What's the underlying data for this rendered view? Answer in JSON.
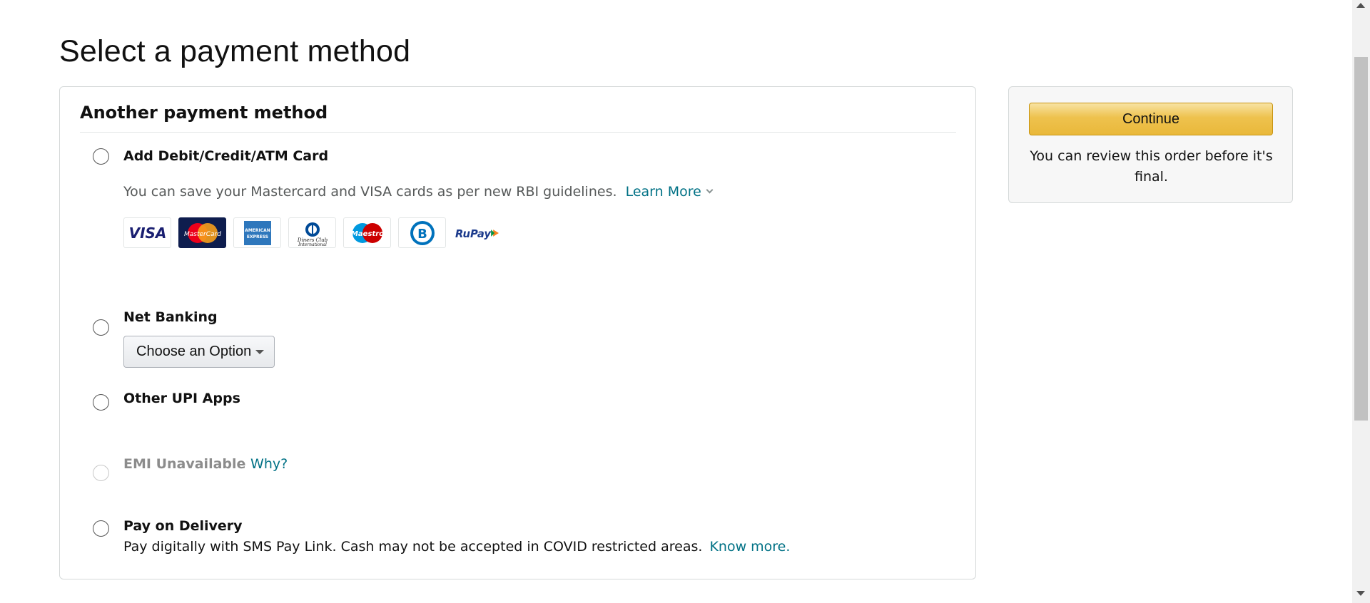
{
  "page": {
    "title": "Select a payment method"
  },
  "main": {
    "section_title": "Another payment method",
    "card_option": {
      "label": "Add Debit/Credit/ATM Card",
      "description": "You can save your Mastercard and VISA cards as per new RBI guidelines.",
      "learn_more": "Learn More",
      "card_logos": [
        "VISA",
        "MasterCard",
        "American Express",
        "Diners Club International",
        "Maestro",
        "Bajaj Finserv",
        "RuPay"
      ]
    },
    "net_banking": {
      "label": "Net Banking",
      "select_value": "Choose an Option"
    },
    "upi": {
      "label": "Other UPI Apps"
    },
    "emi": {
      "label": "EMI Unavailable",
      "why_link": "Why?"
    },
    "pod": {
      "label": "Pay on Delivery",
      "description": "Pay digitally with SMS Pay Link. Cash may not be accepted in COVID restricted areas.",
      "know_more": "Know more."
    }
  },
  "sidebar": {
    "continue_label": "Continue",
    "review_text": "You can review this order before it's final."
  },
  "colors": {
    "link": "#007185",
    "button_yellow": "#f0c14b",
    "border": "#d5d9d9"
  }
}
